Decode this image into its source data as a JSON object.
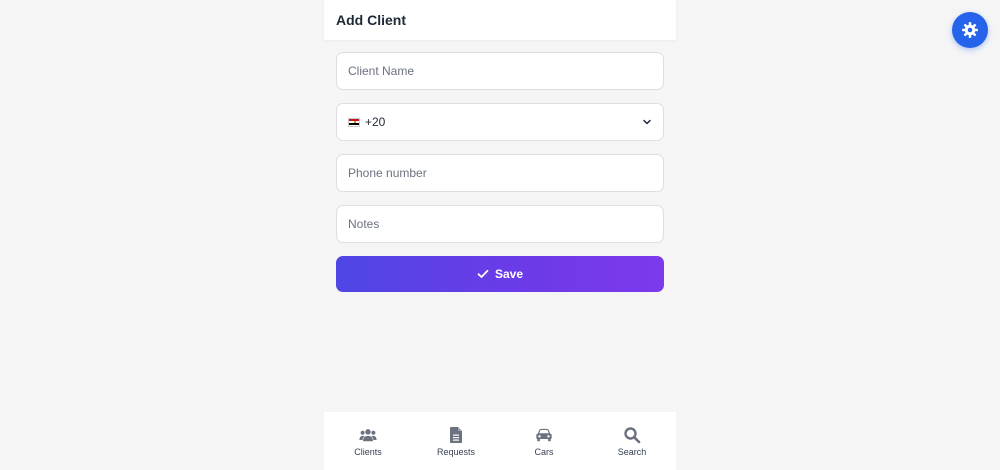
{
  "header": {
    "title": "Add Client"
  },
  "form": {
    "client_name_placeholder": "Client Name",
    "country_code": "+20",
    "country_flag": "egypt-flag-icon",
    "phone_placeholder": "Phone number",
    "notes_placeholder": "Notes",
    "save_label": "Save"
  },
  "nav": {
    "items": [
      {
        "label": "Clients",
        "icon": "users-icon"
      },
      {
        "label": "Requests",
        "icon": "document-icon"
      },
      {
        "label": "Cars",
        "icon": "car-icon"
      },
      {
        "label": "Search",
        "icon": "search-icon"
      }
    ]
  },
  "colors": {
    "accent_start": "#4f46e5",
    "accent_end": "#7c3aed",
    "settings_button": "#2563eb",
    "nav_icon": "#6b7280"
  }
}
